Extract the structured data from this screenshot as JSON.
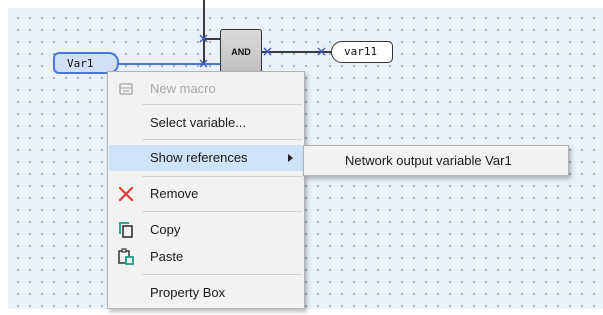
{
  "diagram": {
    "input_variable": "Var1",
    "block": "AND",
    "output_variable": "var11"
  },
  "context_menu": {
    "items": [
      {
        "label": "New macro",
        "enabled": false,
        "icon": "macro-icon"
      },
      {
        "label": "Select variable...",
        "enabled": true
      },
      {
        "label": "Show references",
        "enabled": true,
        "highlighted": true,
        "submenu": true
      },
      {
        "label": "Remove",
        "enabled": true,
        "icon": "remove-icon"
      },
      {
        "label": "Copy",
        "enabled": true,
        "icon": "copy-icon"
      },
      {
        "label": "Paste",
        "enabled": true,
        "icon": "paste-icon"
      },
      {
        "label": "Property Box",
        "enabled": true
      }
    ]
  },
  "submenu": {
    "items": [
      {
        "label": "Network output variable Var1"
      }
    ]
  },
  "colors": {
    "canvas": "#e9f0f8",
    "selection": "#4a78d6",
    "highlight": "#cde3f7",
    "remove": "#e03c2f",
    "copy": "#1a9c84"
  }
}
